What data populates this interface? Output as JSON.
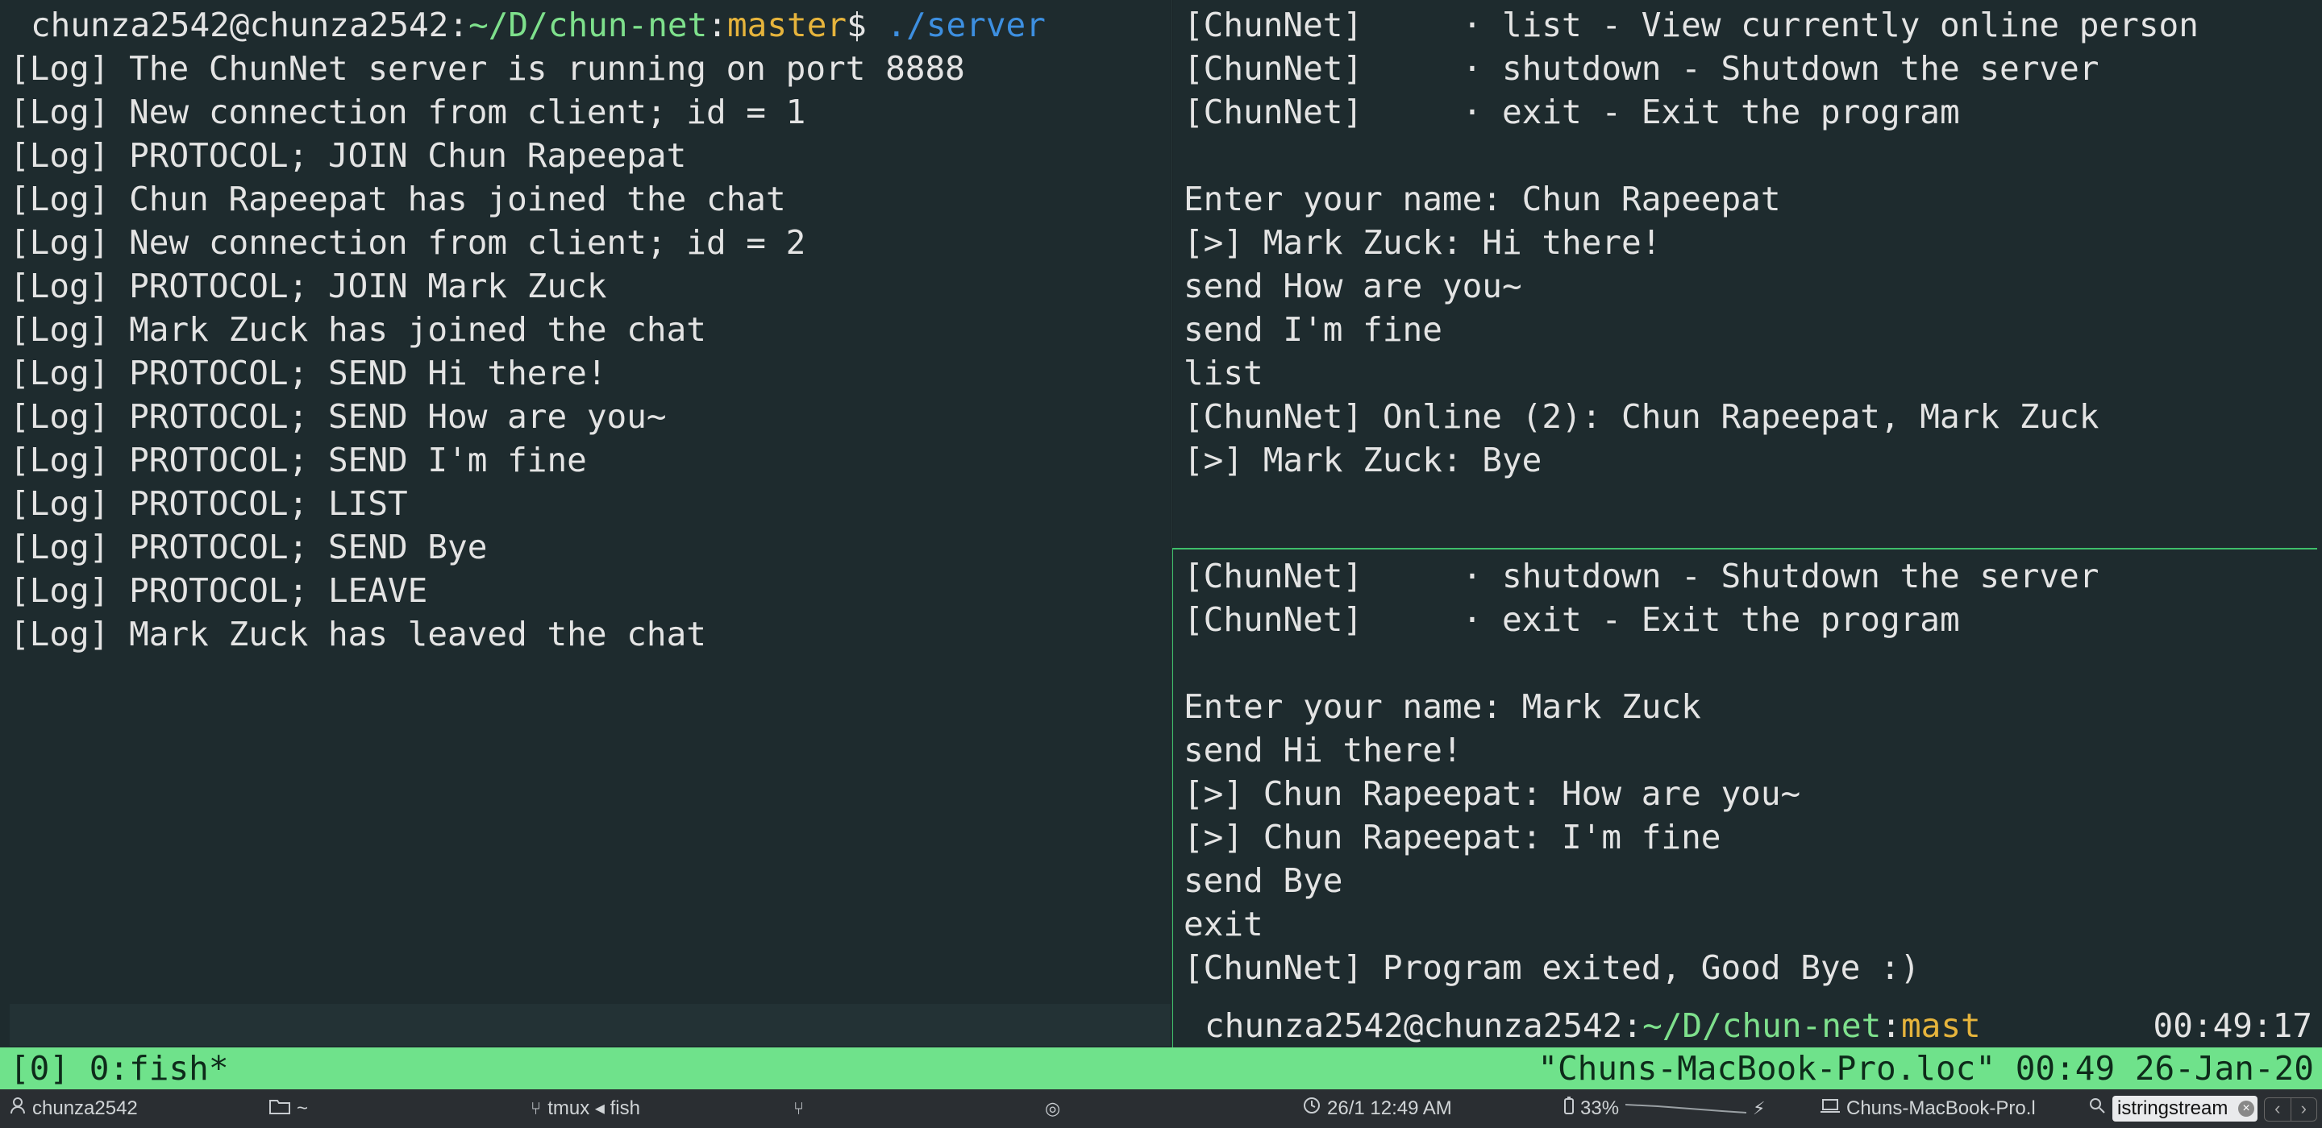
{
  "left_pane": {
    "prompt": {
      "user_host": "chunza2542@chunza2542",
      "sep": ":",
      "path": "~/D/chun-net",
      "colon": ":",
      "branch": "master",
      "dollar": "$",
      "command": " ./server"
    },
    "lines": [
      "[Log] The ChunNet server is running on port 8888",
      "[Log] New connection from client; id = 1",
      "[Log] PROTOCOL; JOIN Chun Rapeepat",
      "[Log] Chun Rapeepat has joined the chat",
      "[Log] New connection from client; id = 2",
      "[Log] PROTOCOL; JOIN Mark Zuck",
      "[Log] Mark Zuck has joined the chat",
      "[Log] PROTOCOL; SEND Hi there!",
      "[Log] PROTOCOL; SEND How are you~",
      "[Log] PROTOCOL; SEND I'm fine",
      "[Log] PROTOCOL; LIST",
      "[Log] PROTOCOL; SEND Bye",
      "[Log] PROTOCOL; LEAVE",
      "[Log] Mark Zuck has leaved the chat"
    ]
  },
  "right_top_pane": {
    "lines": [
      "[ChunNet]     · list - View currently online person",
      "[ChunNet]     · shutdown - Shutdown the server",
      "[ChunNet]     · exit - Exit the program",
      "",
      "Enter your name: Chun Rapeepat",
      "[>] Mark Zuck: Hi there!",
      "send How are you~",
      "send I'm fine",
      "list",
      "[ChunNet] Online (2): Chun Rapeepat, Mark Zuck",
      "[>] Mark Zuck: Bye"
    ]
  },
  "right_bottom_pane": {
    "lines": [
      "[ChunNet]     · shutdown - Shutdown the server",
      "[ChunNet]     · exit - Exit the program",
      "",
      "Enter your name: Mark Zuck",
      "send Hi there!",
      "[>] Chun Rapeepat: How are you~",
      "[>] Chun Rapeepat: I'm fine",
      "send Bye",
      "exit",
      "[ChunNet] Program exited, Good Bye :)"
    ],
    "prompt": {
      "user_host": "chunza2542@chunza2542",
      "sep": ":",
      "path": "~/D/chun-net",
      "colon": ":",
      "branch": "master",
      "dollar": "$"
    },
    "clock": "00:49:17"
  },
  "tmux": {
    "left": "[0] 0:fish*",
    "right": "\"Chuns-MacBook-Pro.loc\" 00:49 26-Jan-20"
  },
  "sysbar": {
    "user": "chunza2542",
    "folder": "~",
    "process": "tmux ◂ fish",
    "datetime": "26/1 12:49 AM",
    "battery": "33%",
    "host": "Chuns-MacBook-Pro.l",
    "search": "istringstream",
    "colors": {
      "accent": "#6fe28b",
      "path": "#7ee08c",
      "branch": "#e6b43c",
      "command": "#3d8fe0"
    }
  }
}
